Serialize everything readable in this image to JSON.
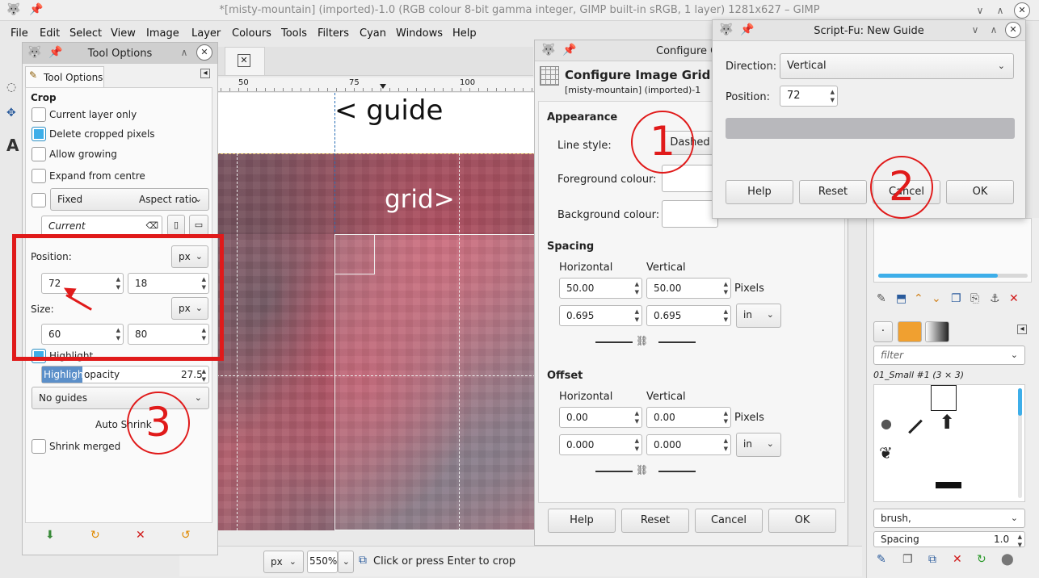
{
  "window": {
    "title": "*[misty-mountain] (imported)-1.0 (RGB colour 8-bit gamma integer, GIMP built-in sRGB, 1 layer) 1281x627 – GIMP"
  },
  "menu": [
    "File",
    "Edit",
    "Select",
    "View",
    "Image",
    "Layer",
    "Colours",
    "Tools",
    "Filters",
    "Cyan",
    "Windows",
    "Help"
  ],
  "ruler": {
    "t50": "50",
    "t75": "75",
    "t100": "100"
  },
  "canvas": {
    "guide_label": "< guide",
    "grid_label": "grid>"
  },
  "status": {
    "unit": "px",
    "zoom": "550%",
    "message": "Click or press Enter to crop"
  },
  "tool_options": {
    "title": "Tool Options",
    "tab": "Tool Options",
    "section": "Crop",
    "current_layer_only": "Current layer only",
    "delete_cropped": "Delete cropped pixels",
    "allow_growing": "Allow growing",
    "expand_centre": "Expand from centre",
    "fixed": "Fixed",
    "aspect": "Aspect ratio",
    "current": "Current",
    "position_label": "Position:",
    "pos_x": "72",
    "pos_y": "18",
    "unit": "px",
    "size_label": "Size:",
    "size_w": "60",
    "size_h": "80",
    "highlight": "Highlight",
    "highlight_opacity_label": "Highlight",
    "opacity_label": "opacity",
    "opacity_value": "27.5",
    "guides": "No guides",
    "auto_shrink": "Auto Shrink",
    "shrink_merged": "Shrink merged"
  },
  "grid_dialog": {
    "title": "Configure G",
    "heading": "Configure Image Grid",
    "subheading": "[misty-mountain] (imported)-1",
    "appearance": "Appearance",
    "line_style_label": "Line style:",
    "line_style": "Dashed",
    "fg_label": "Foreground colour:",
    "bg_label": "Background colour:",
    "spacing": "Spacing",
    "horizontal": "Horizontal",
    "vertical": "Vertical",
    "sp_h": "50.00",
    "sp_v": "50.00",
    "pixels": "Pixels",
    "sp_h_in": "0.695",
    "sp_v_in": "0.695",
    "in": "in",
    "offset": "Offset",
    "off_h": "0.00",
    "off_v": "0.00",
    "off_h_in": "0.000",
    "off_v_in": "0.000",
    "help": "Help",
    "reset": "Reset",
    "cancel": "Cancel",
    "ok": "OK"
  },
  "new_guide": {
    "title": "Script-Fu: New Guide",
    "direction_label": "Direction:",
    "direction": "Vertical",
    "position_label": "Position:",
    "position": "72",
    "help": "Help",
    "reset": "Reset",
    "cancel": "Cancel",
    "ok": "OK"
  },
  "brushes": {
    "filter": "filter",
    "name": "01_Small #1 (3 × 3)",
    "brush_tag": "brush,",
    "spacing_label": "Spacing",
    "spacing_value": "1.0"
  },
  "annotations": {
    "c1": "1",
    "c2": "2",
    "c3": "3"
  },
  "colors": {
    "accent": "#3daee9",
    "annotation": "#e01a1a"
  }
}
